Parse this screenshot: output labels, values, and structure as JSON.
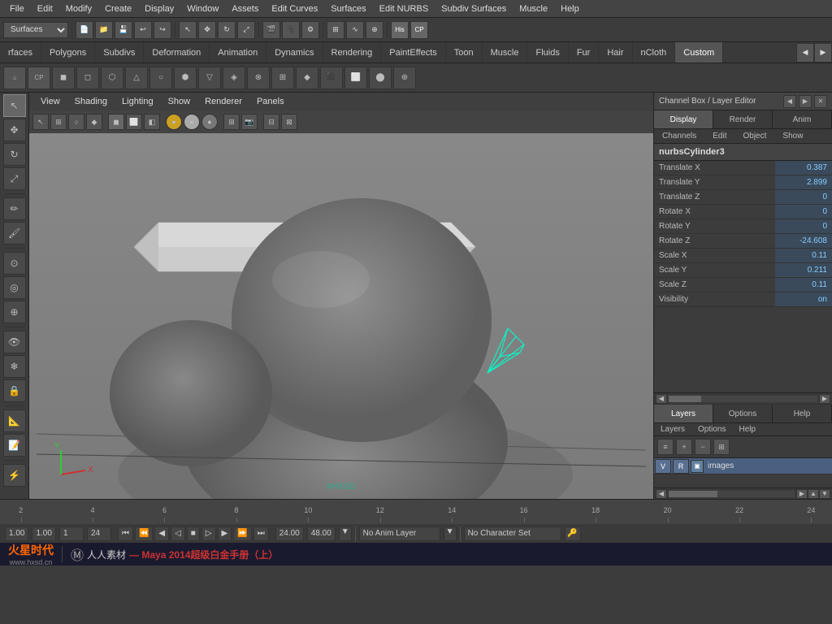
{
  "menubar": {
    "items": [
      "File",
      "Edit",
      "Modify",
      "Create",
      "Display",
      "Window",
      "Assets",
      "Edit Curves",
      "Surfaces",
      "Edit NURBS",
      "Subdiv Surfaces",
      "Muscle",
      "Help"
    ]
  },
  "toolbar": {
    "dropdown_value": "Surfaces"
  },
  "shelftabs": {
    "tabs": [
      "rfaces",
      "Polygons",
      "Subdivs",
      "Deformation",
      "Animation",
      "Dynamics",
      "Rendering",
      "PaintEffects",
      "Toon",
      "Muscle",
      "Fluids",
      "Fur",
      "Hair",
      "nCloth",
      "Custom"
    ]
  },
  "viewport": {
    "menus": [
      "View",
      "Shading",
      "Lighting",
      "Show",
      "Renderer",
      "Panels"
    ]
  },
  "channel_box": {
    "title": "Channel Box / Layer Editor",
    "tabs": [
      "Display",
      "Render",
      "Anim"
    ],
    "menus": [
      "Channels",
      "Edit",
      "Object",
      "Show"
    ],
    "object_name": "nurbsCylinder3",
    "attributes": [
      {
        "label": "Translate X",
        "value": "0.387"
      },
      {
        "label": "Translate Y",
        "value": "2.899"
      },
      {
        "label": "Translate Z",
        "value": "0"
      },
      {
        "label": "Rotate X",
        "value": "0"
      },
      {
        "label": "Rotate Y",
        "value": "0"
      },
      {
        "label": "Rotate Z",
        "value": "-24.608"
      },
      {
        "label": "Scale X",
        "value": "0.11"
      },
      {
        "label": "Scale Y",
        "value": "0.211"
      },
      {
        "label": "Scale Z",
        "value": "0.11"
      },
      {
        "label": "Visibility",
        "value": "on"
      }
    ]
  },
  "layer_editor": {
    "tabs": [
      "Layers",
      "Options",
      "Help"
    ],
    "layers": [
      {
        "v": "V",
        "r": "R",
        "color": "#6080a0",
        "name": "images"
      }
    ]
  },
  "timeline": {
    "ticks": [
      2,
      4,
      6,
      8,
      10,
      12,
      14,
      16,
      18,
      20,
      22,
      24
    ],
    "start": "1.00",
    "end": "24.00",
    "max": "48.00"
  },
  "statusbar": {
    "current_frame": "1.00",
    "value1": "1.00",
    "value2": "1",
    "value3": "24",
    "time_current": "24.00",
    "time_max": "48.00",
    "anim_layer": "No Anim Layer",
    "char_set": "No Character Set"
  },
  "bottombar": {
    "brand": "火星时代",
    "brand_url": "www.hxsd.cn",
    "separator_text": "人人素材",
    "title": "— Maya 2014超级白金手册（上）"
  },
  "icons": {
    "arrow": "▶",
    "move": "✥",
    "rotate": "↻",
    "scale": "⤢",
    "select": "↖",
    "chevron_left": "◀",
    "chevron_right": "▶",
    "chevron_down": "▼"
  }
}
